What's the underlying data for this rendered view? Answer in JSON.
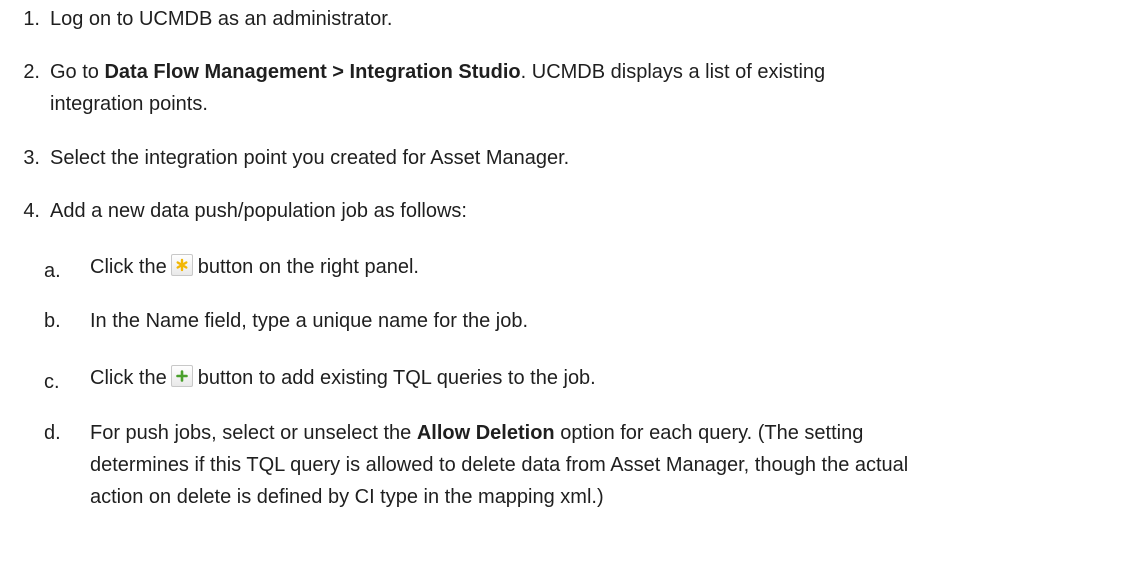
{
  "steps": [
    {
      "number": "1.",
      "text": "Log on to UCMDB as an administrator."
    },
    {
      "number": "2.",
      "pre": "Go to ",
      "bold": "Data Flow Management > Integration Studio",
      "post": ". UCMDB displays a list of existing",
      "line2": "integration points."
    },
    {
      "number": "3.",
      "text": "Select the integration point you created for Asset Manager."
    },
    {
      "number": "4.",
      "text": "Add a new data push/population job as follows:"
    }
  ],
  "substeps": [
    {
      "letter": "a.",
      "pre": "Click the",
      "icon": "new-job-asterisk-icon",
      "post": "button on the right panel."
    },
    {
      "letter": "b.",
      "text": "In the Name field, type a unique name for the job."
    },
    {
      "letter": "c.",
      "pre": "Click the",
      "icon": "add-plus-icon",
      "post": "button to add existing TQL queries to the job."
    },
    {
      "letter": "d.",
      "pre": "For push jobs, select or unselect the ",
      "bold": "Allow Deletion",
      "post": " option for each query. (The setting",
      "line2": "determines if this TQL query is allowed to delete data from Asset Manager, though the actual",
      "line3": "action on delete is defined by CI type in the mapping xml.)"
    }
  ],
  "colors": {
    "asterisk": "#f2b705",
    "plus": "#4aa02c"
  }
}
